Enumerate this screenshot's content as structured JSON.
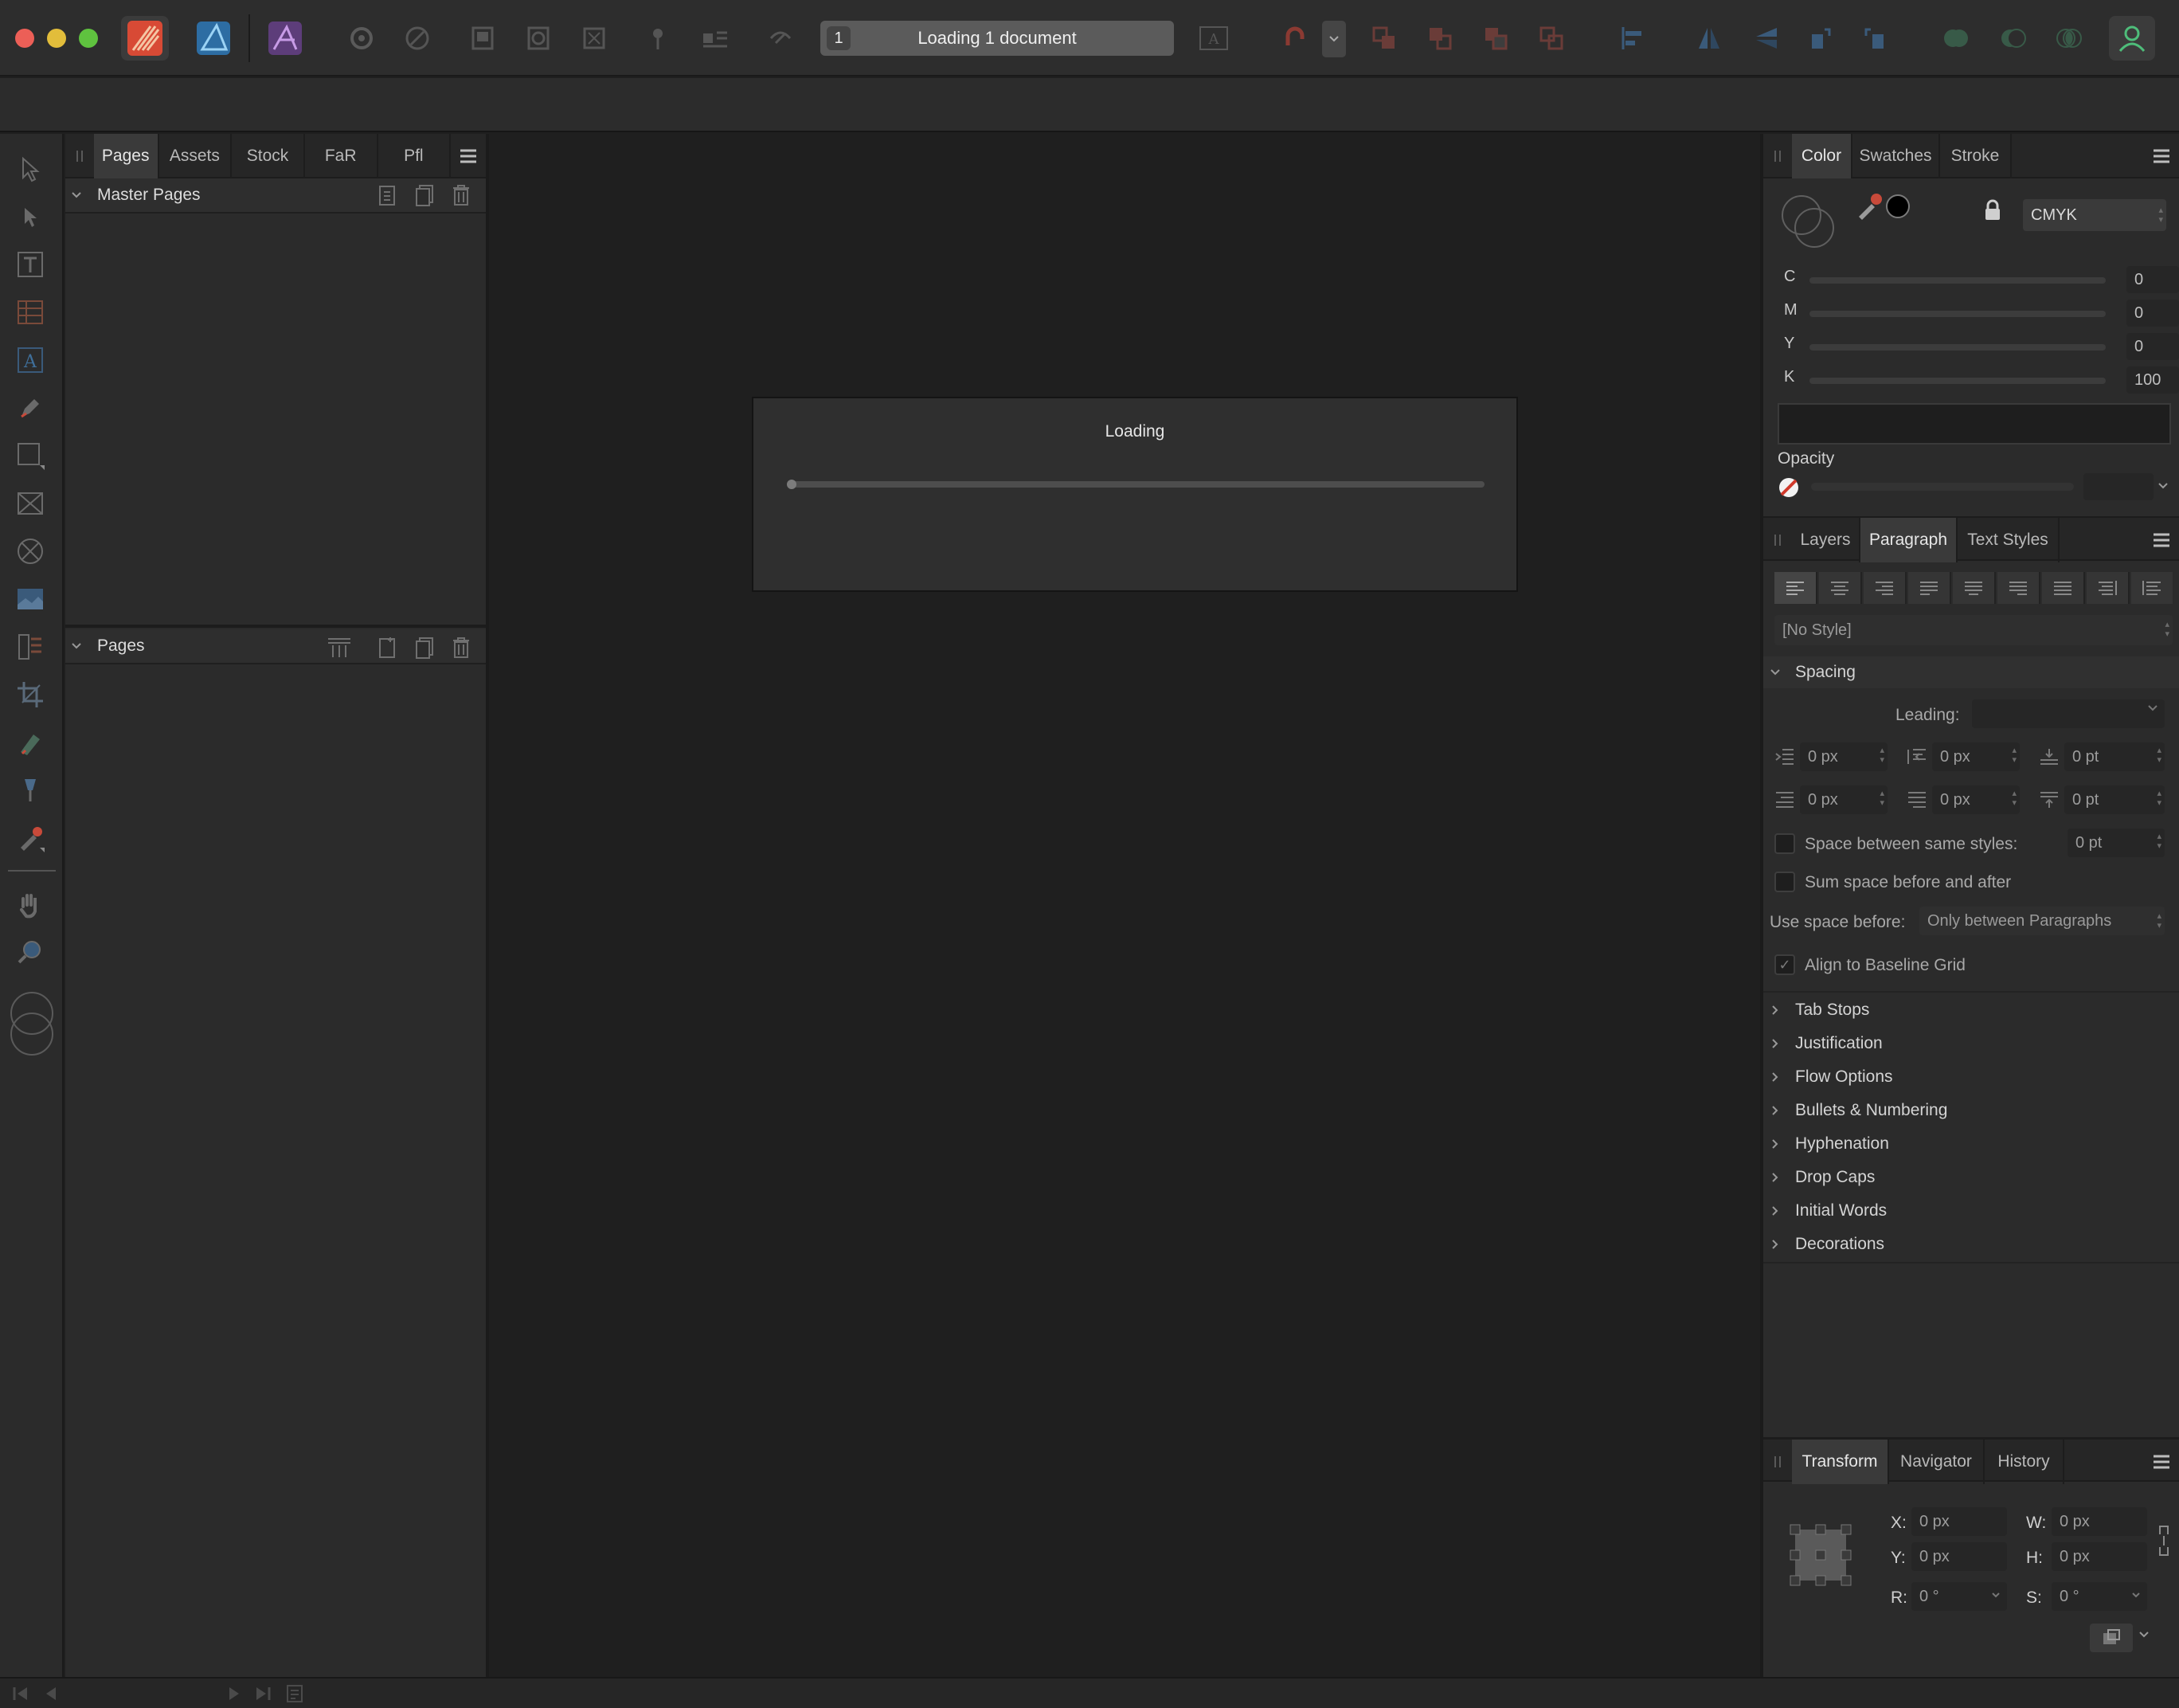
{
  "toolbar": {
    "status_count": "1",
    "status_text": "Loading 1 document",
    "apps": [
      {
        "name": "publisher-persona",
        "color": "#e0553d"
      },
      {
        "name": "designer-persona",
        "color": "#3f86c4"
      },
      {
        "name": "photo-persona",
        "color": "#8a4fb4"
      }
    ]
  },
  "pages_panel": {
    "tabs": [
      "Pages",
      "Assets",
      "Stock",
      "FaR",
      "Pfl"
    ],
    "master_pages_label": "Master Pages",
    "pages_label": "Pages"
  },
  "dialog": {
    "title": "Loading",
    "progress": 0.0
  },
  "color_panel": {
    "tabs": [
      "Color",
      "Swatches",
      "Stroke"
    ],
    "mode": "CMYK",
    "channels": [
      {
        "label": "C",
        "value": "0"
      },
      {
        "label": "M",
        "value": "0"
      },
      {
        "label": "Y",
        "value": "0"
      },
      {
        "label": "K",
        "value": "100"
      }
    ],
    "opacity_label": "Opacity"
  },
  "paragraph_panel": {
    "tabs": [
      "Layers",
      "Paragraph",
      "Text Styles"
    ],
    "style_value": "[No Style]",
    "spacing_label": "Spacing",
    "leading_label": "Leading:",
    "indent_fields": [
      "0 px",
      "0 px",
      "0 pt",
      "0 px",
      "0 px",
      "0 pt"
    ],
    "space_between_label": "Space between same styles:",
    "space_between_value": "0 pt",
    "sum_space_label": "Sum space before and after",
    "use_space_before_label": "Use space before:",
    "use_space_before_value": "Only between Paragraphs",
    "align_baseline_label": "Align to Baseline Grid",
    "sections": [
      "Tab Stops",
      "Justification",
      "Flow Options",
      "Bullets & Numbering",
      "Hyphenation",
      "Drop Caps",
      "Initial Words",
      "Decorations"
    ]
  },
  "transform_panel": {
    "tabs": [
      "Transform",
      "Navigator",
      "History"
    ],
    "x_label": "X:",
    "x_value": "0 px",
    "y_label": "Y:",
    "y_value": "0 px",
    "w_label": "W:",
    "w_value": "0 px",
    "h_label": "H:",
    "h_value": "0 px",
    "r_label": "R:",
    "r_value": "0 °",
    "s_label": "S:",
    "s_value": "0 °"
  }
}
